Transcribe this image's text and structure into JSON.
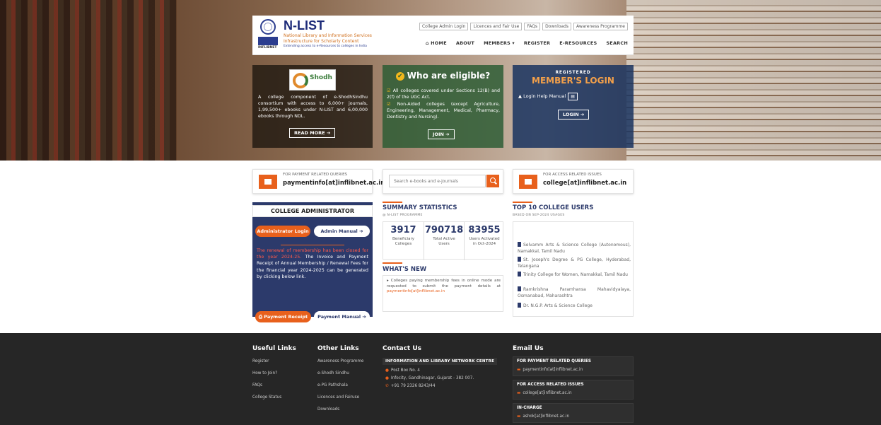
{
  "brand": {
    "name": "N-LIST",
    "sub1": "National Library and Information Services",
    "sub2": "Infrastructure for Scholarly Content",
    "sub3": "Extending access to e-Resources to colleges in India",
    "logo_tag": "INFLIBNET"
  },
  "toplinks": [
    "College Admin Login",
    "Licences and Fair Use",
    "FAQs",
    "Downloads",
    "Awareness Programme"
  ],
  "nav": {
    "home": "HOME",
    "about": "ABOUT",
    "members": "MEMBERS",
    "register": "REGISTER",
    "eresources": "E-RESOURCES",
    "search": "SEARCH"
  },
  "hero": {
    "left": {
      "logo_text": "Shodh",
      "desc": "A college component of e-ShodhSindhu consortium with access to 6,000+ journals, 1,99,500+ ebooks under N-LIST and 6,00,000 ebooks through NDL.",
      "button": "READ MORE"
    },
    "mid": {
      "title": "Who are eligible?",
      "item1": "All colleges covered under Sections 12(B) and 2(f) of the UGC Act.",
      "item2": "Non-Aided colleges (except Agriculture, Engineering, Management, Medical, Pharmacy, Dentistry and Nursing).",
      "button": "JOIN"
    },
    "right": {
      "registered": "REGISTERED",
      "title": "MEMBER'S LOGIN",
      "help": "Login Help Manual",
      "button": "LOGIN"
    }
  },
  "payment_card": {
    "label": "FOR PAYMENT RELATED QUERIES",
    "value": "paymentinfo[at]inflibnet.ac.in"
  },
  "access_card": {
    "label": "FOR ACCESS RELATED ISSUES",
    "value": "college[at]inflibnet.ac.in"
  },
  "search": {
    "placeholder": "Search e-books and e-journals"
  },
  "admin": {
    "title": "COLLEGE ADMINISTRATOR",
    "login": "Administrator Login",
    "manual": "Admin Manual",
    "note_red": "The renewal of membership has been closed for the year 2024-25.",
    "note_white": " The Invoice and Payment Receipt of Annual Membership / Renewal Fees for the financial year 2024-2025 can be generated by clicking below link.",
    "receipt": "Payment Receipt",
    "pay_manual": "Payment Manual"
  },
  "summary": {
    "title": "SUMMARY STATISTICS",
    "sub": "@ N-LIST PROGRAMME",
    "stats": [
      {
        "n": "3917",
        "l1": "Beneficiary",
        "l2": "Colleges"
      },
      {
        "n": "790718",
        "l1": "Total Active",
        "l2": "Users"
      },
      {
        "n": "83955",
        "l1": "Users Activated",
        "l2": "in Oct-2024"
      }
    ]
  },
  "whatsnew": {
    "title": "WHAT'S NEW",
    "text": "Colleges paying membership fees in online mode are requested to submit the payment details at ",
    "link": "paymentinfo[at]inflibnet.ac.in"
  },
  "topusers": {
    "title": "TOP 10 COLLEGE USERS",
    "sub": "BASED ON SEP-2024 USAGES",
    "items": [
      "Selvamm Arts & Science College (Autonomous), Namakkal, Tamil Nadu",
      "St. Joseph's Degree & PG College, Hyderabad, Telangana",
      "Trinity College for Women, Namakkal, Tamil Nadu",
      "Ramkrishna Paramhansa Mahavidyalaya, Osmanabad, Maharashtra",
      "Dr. N.G.P. Arts & Science College"
    ]
  },
  "footer": {
    "useful": {
      "title": "Useful Links",
      "links": [
        "Register",
        "How to Join?",
        "FAQs",
        "College Status"
      ]
    },
    "other": {
      "title": "Other Links",
      "links": [
        "Awareness Programme",
        "e-Shodh Sindhu",
        "e-PG Pathshala",
        "Licences and Fairuse",
        "Downloads"
      ]
    },
    "contact": {
      "title": "Contact Us",
      "head": "INFORMATION AND LIBRARY NETWORK CENTRE",
      "line1": "Post Box No. 4",
      "line2": "Infocity, Gandhinagar, Gujarat - 382 007.",
      "line3": "+91 79 2326 8243/44"
    },
    "email": {
      "title": "Email Us",
      "h1": "FOR PAYMENT RELATED QUERIES",
      "v1": "paymentinfo[at]inflibnet.ac.in",
      "h2": "FOR ACCESS RELATED ISSUES",
      "v2": "college[at]inflibnet.ac.in",
      "h3": "IN-CHARGE",
      "v3": "ashok[at]inflibnet.ac.in"
    }
  },
  "colors": {
    "accent": "#e8601c",
    "navy": "#2c3a6b",
    "footer": "#262626"
  }
}
